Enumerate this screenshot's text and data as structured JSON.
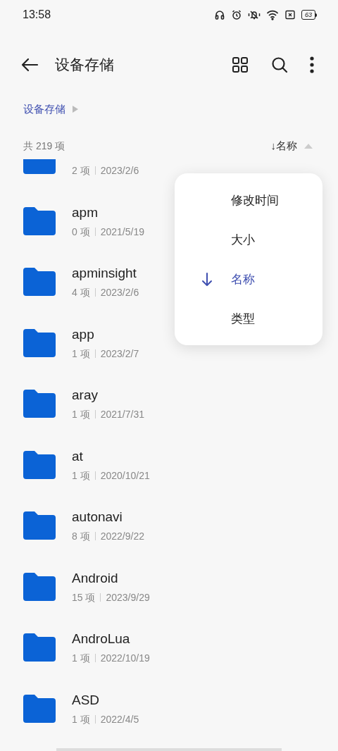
{
  "status_bar": {
    "time": "13:58",
    "battery": "63"
  },
  "header": {
    "title": "设备存储"
  },
  "breadcrumb": [
    {
      "label": "设备存储"
    }
  ],
  "list_header": {
    "count": "共 219 项",
    "sort_label": "↓名称"
  },
  "files": [
    {
      "meta_count": "2 项",
      "meta_date": "2023/2/6"
    },
    {
      "name": "apm",
      "meta_count": "0 项",
      "meta_date": "2021/5/19"
    },
    {
      "name": "apminsight",
      "meta_count": "4 项",
      "meta_date": "2023/2/6"
    },
    {
      "name": "app",
      "meta_count": "1 项",
      "meta_date": "2023/2/7"
    },
    {
      "name": "aray",
      "meta_count": "1 项",
      "meta_date": "2021/7/31"
    },
    {
      "name": "at",
      "meta_count": "1 项",
      "meta_date": "2020/10/21"
    },
    {
      "name": "autonavi",
      "meta_count": "8 项",
      "meta_date": "2022/9/22"
    },
    {
      "name": "Android",
      "meta_count": "15 项",
      "meta_date": "2023/9/29"
    },
    {
      "name": "AndroLua",
      "meta_count": "1 项",
      "meta_date": "2022/10/19"
    },
    {
      "name": "ASD",
      "meta_count": "1 项",
      "meta_date": "2022/4/5"
    }
  ],
  "sort_menu": [
    {
      "label": "修改时间",
      "selected": false
    },
    {
      "label": "大小",
      "selected": false
    },
    {
      "label": "名称",
      "selected": true
    },
    {
      "label": "类型",
      "selected": false
    }
  ]
}
